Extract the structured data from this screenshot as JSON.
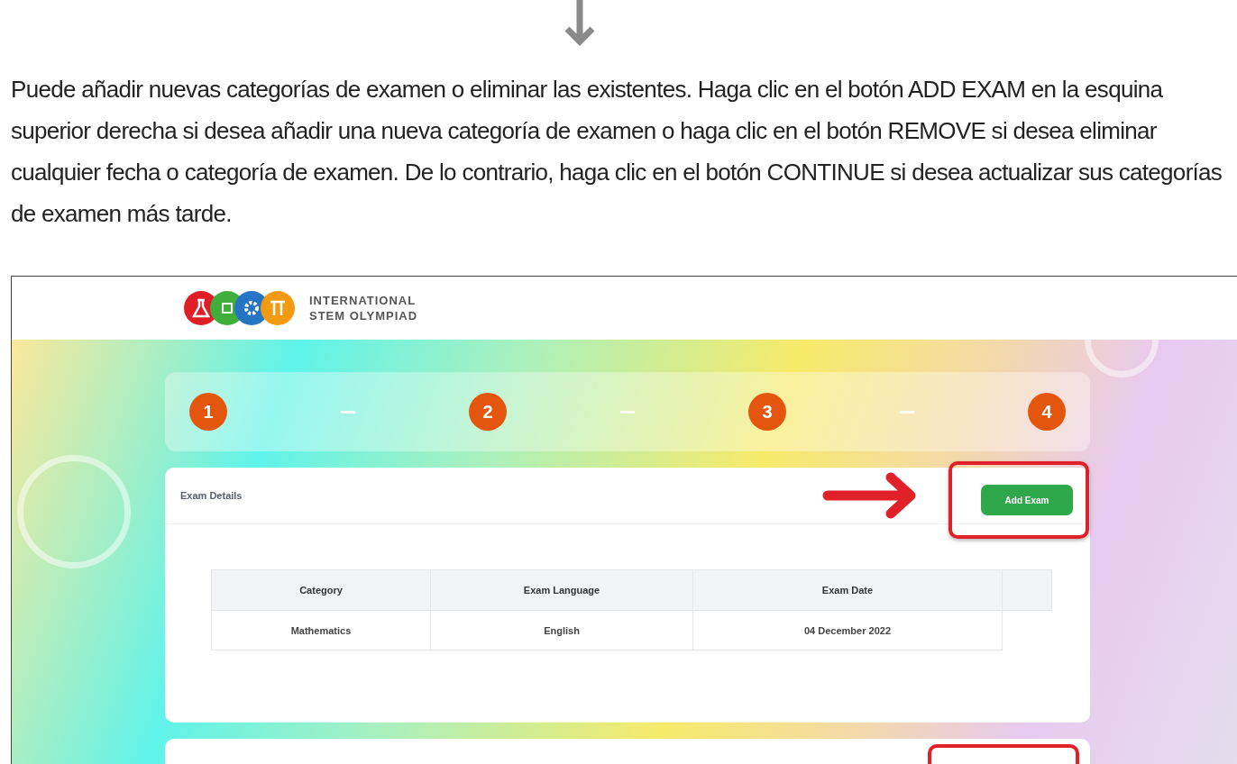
{
  "instruction": "Puede añadir nuevas categorías de examen o eliminar las existentes. Haga clic en el botón ADD EXAM en la esquina superior derecha si desea añadir una nueva categoría de examen o haga clic en el botón REMOVE si desea eliminar cualquier fecha o categoría de examen. De lo contrario, haga clic en el botón CONTINUE si desea actualizar sus categorías de examen más tarde.",
  "logo": {
    "line1": "INTERNATIONAL",
    "line2": "STEM OLYMPIAD"
  },
  "steps": [
    "1",
    "2",
    "3",
    "4"
  ],
  "exam_card": {
    "title": "Exam Details",
    "button": "Add Exam"
  },
  "table": {
    "columns": [
      "Category",
      "Exam Language",
      "Exam Date"
    ],
    "rows": [
      [
        "Mathematics",
        "English",
        "04 December 2022"
      ]
    ]
  }
}
